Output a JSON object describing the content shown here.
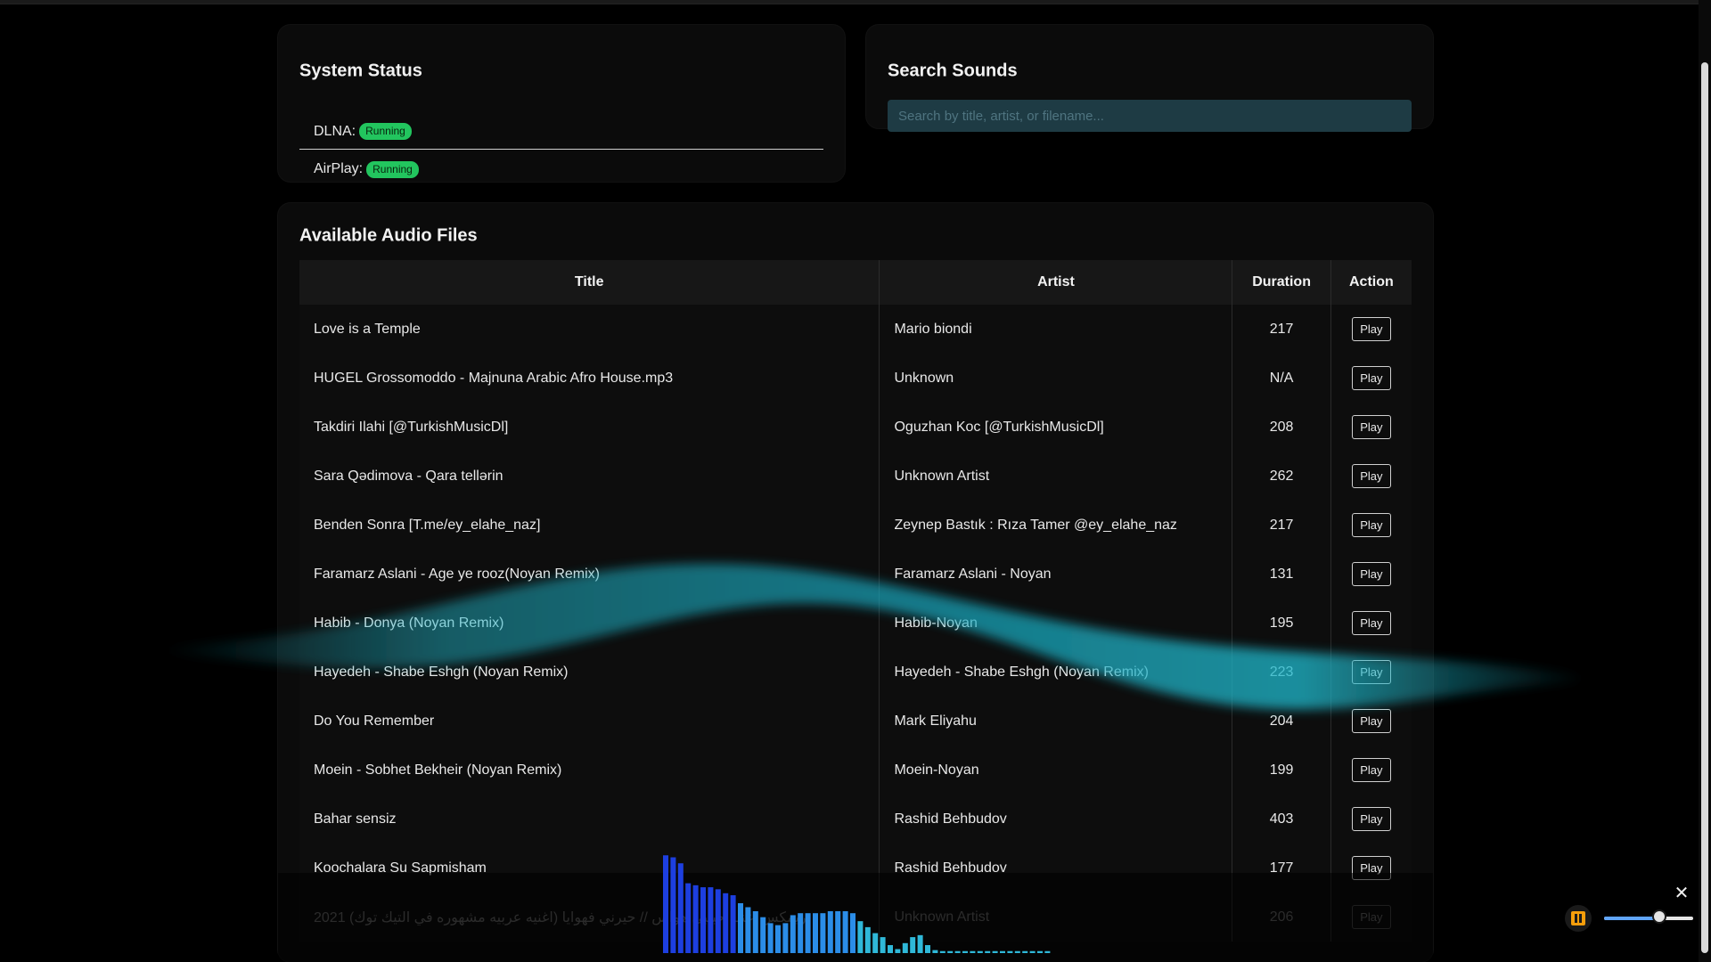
{
  "status": {
    "title": "System Status",
    "items": [
      {
        "label": "DLNA:",
        "state": "Running"
      },
      {
        "label": "AirPlay:",
        "state": "Running"
      }
    ]
  },
  "search": {
    "title": "Search Sounds",
    "placeholder": "Search by title, artist, or filename..."
  },
  "files": {
    "title": "Available Audio Files",
    "columns": [
      "Title",
      "Artist",
      "Duration",
      "Action"
    ],
    "play_label": "Play",
    "rows": [
      {
        "title": "Love is a Temple",
        "artist": "Mario biondi",
        "duration": "217"
      },
      {
        "title": "HUGEL Grossomoddo - Majnuna Arabic Afro House.mp3",
        "artist": "Unknown",
        "duration": "N/A"
      },
      {
        "title": "Takdiri Ilahi [@TurkishMusicDl]",
        "artist": "Oguzhan Koc [@TurkishMusicDl]",
        "duration": "208"
      },
      {
        "title": "Sara Qədimova - Qara tellərin",
        "artist": "Unknown Artist",
        "duration": "262"
      },
      {
        "title": "Benden Sonra [T.me/ey_elahe_naz]",
        "artist": "Zeynep Bastık : Rıza Tamer @ey_elahe_naz",
        "duration": "217"
      },
      {
        "title": "Faramarz Aslani - Age ye rooz(Noyan Remix)",
        "artist": "Faramarz Aslani - Noyan",
        "duration": "131"
      },
      {
        "title": "Habib - Donya (Noyan Remix)",
        "artist": "Habib-Noyan",
        "duration": "195"
      },
      {
        "title": "Hayedeh - Shabe Eshgh (Noyan Remix)",
        "artist": "Hayedeh - Shabe Eshgh (Noyan Remix)",
        "duration": "223"
      },
      {
        "title": "Do You Remember",
        "artist": "Mark Eliyahu",
        "duration": "204"
      },
      {
        "title": "Moein - Sobhet Bekheir (Noyan Remix)",
        "artist": "Moein-Noyan",
        "duration": "199"
      },
      {
        "title": "Bahar sensiz",
        "artist": "Rashid Behbudov",
        "duration": "403"
      },
      {
        "title": "Koochalara Su Sapmisham",
        "artist": "Rashid Behbudov",
        "duration": "177"
      },
      {
        "title": "ريمكس اغنيه حبيبي هواس // حيرني فهوايا (اغنيه عربيه مشهوره في التيك توك) 2021",
        "artist": "Unknown Artist",
        "duration": "206"
      }
    ]
  },
  "player": {
    "volume": 0.62,
    "spectrum_levels": [
      0.98,
      0.96,
      0.9,
      0.7,
      0.68,
      0.66,
      0.66,
      0.64,
      0.6,
      0.58,
      0.5,
      0.46,
      0.42,
      0.36,
      0.3,
      0.28,
      0.3,
      0.38,
      0.4,
      0.4,
      0.4,
      0.4,
      0.42,
      0.42,
      0.42,
      0.4,
      0.32,
      0.26,
      0.2,
      0.16,
      0.08,
      0.04,
      0.1,
      0.16,
      0.18,
      0.08,
      0.03,
      0.02,
      0.02,
      0.02,
      0.02,
      0.02,
      0.02,
      0.02,
      0.02,
      0.02,
      0.02,
      0.02,
      0.02,
      0.02,
      0.02,
      0.02
    ]
  },
  "colors": {
    "badge": "#22c55e",
    "wave": "#1fb6c9",
    "spectrum": "#1d4ed8"
  }
}
